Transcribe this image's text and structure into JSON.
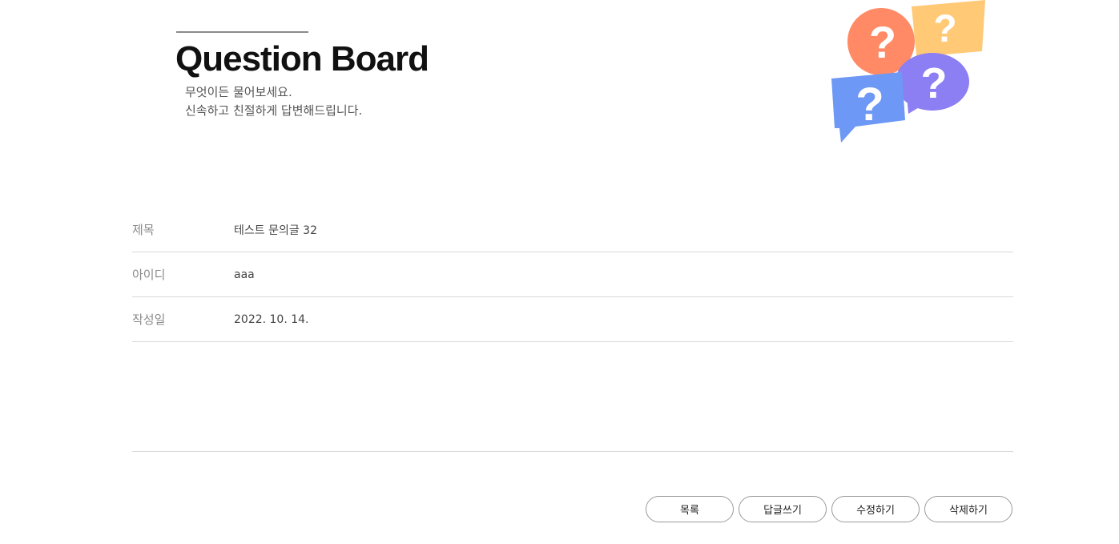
{
  "header": {
    "title": "Question Board",
    "subtitle_line1": "무엇이든 물어보세요.",
    "subtitle_line2": "신속하고 친절하게 답변해드립니다."
  },
  "illustration": {
    "icon": "question-bubbles-icon",
    "colors": {
      "orange": "#FF8A65",
      "yellow": "#FFC976",
      "purple": "#8C7EF3",
      "blue": "#6E98F5"
    }
  },
  "post": {
    "rows": [
      {
        "label": "제목",
        "value": "테스트 문의글 32"
      },
      {
        "label": "아이디",
        "value": "aaa"
      },
      {
        "label": "작성일",
        "value": "2022. 10. 14."
      }
    ],
    "content": ""
  },
  "buttons": {
    "list": "목록",
    "reply": "답글쓰기",
    "edit": "수정하기",
    "delete": "삭제하기"
  }
}
